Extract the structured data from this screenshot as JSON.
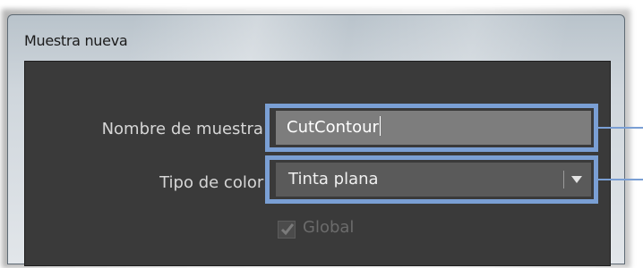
{
  "window": {
    "title": "Muestra nueva"
  },
  "form": {
    "name_label": "Nombre de muestra:",
    "name_value": "CutContour",
    "color_type_label": "Tipo de color:",
    "color_type_value": "Tinta plana",
    "global_label": "Global",
    "global_checked": true,
    "global_enabled": false
  },
  "icons": {
    "dropdown": "chevron-down-icon",
    "checkbox": "checkmark-icon"
  },
  "colors": {
    "panel_bg": "#3a3a3a",
    "highlight": "#7a9fd4",
    "input_bg": "#7d7d7d",
    "select_bg": "#5a5a5a"
  }
}
